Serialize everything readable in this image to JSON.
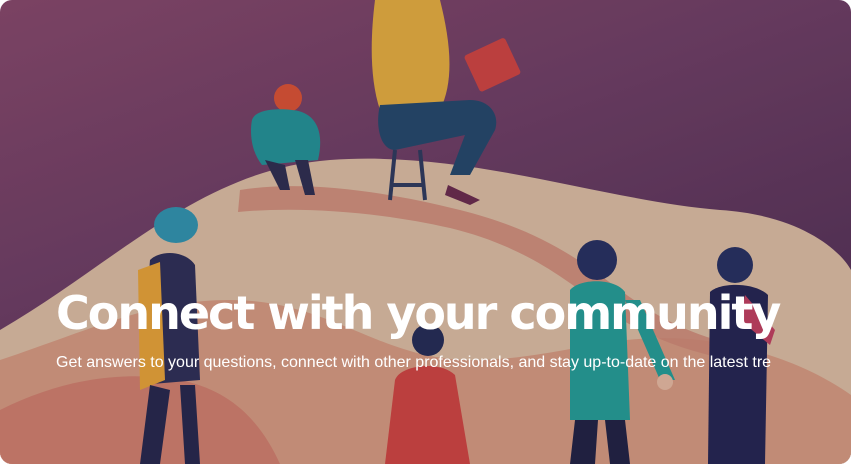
{
  "hero": {
    "title": "Connect with your community",
    "subtitle": "Get answers to your questions, connect with other professionals, and stay up-to-date on the latest tre"
  },
  "illustration": {
    "icon": "community-illustration",
    "colors": {
      "background": "#6e3f63",
      "hill_light": "#e8cfae",
      "path": "#d79a80",
      "hill_warm": "#e39a7f"
    }
  }
}
